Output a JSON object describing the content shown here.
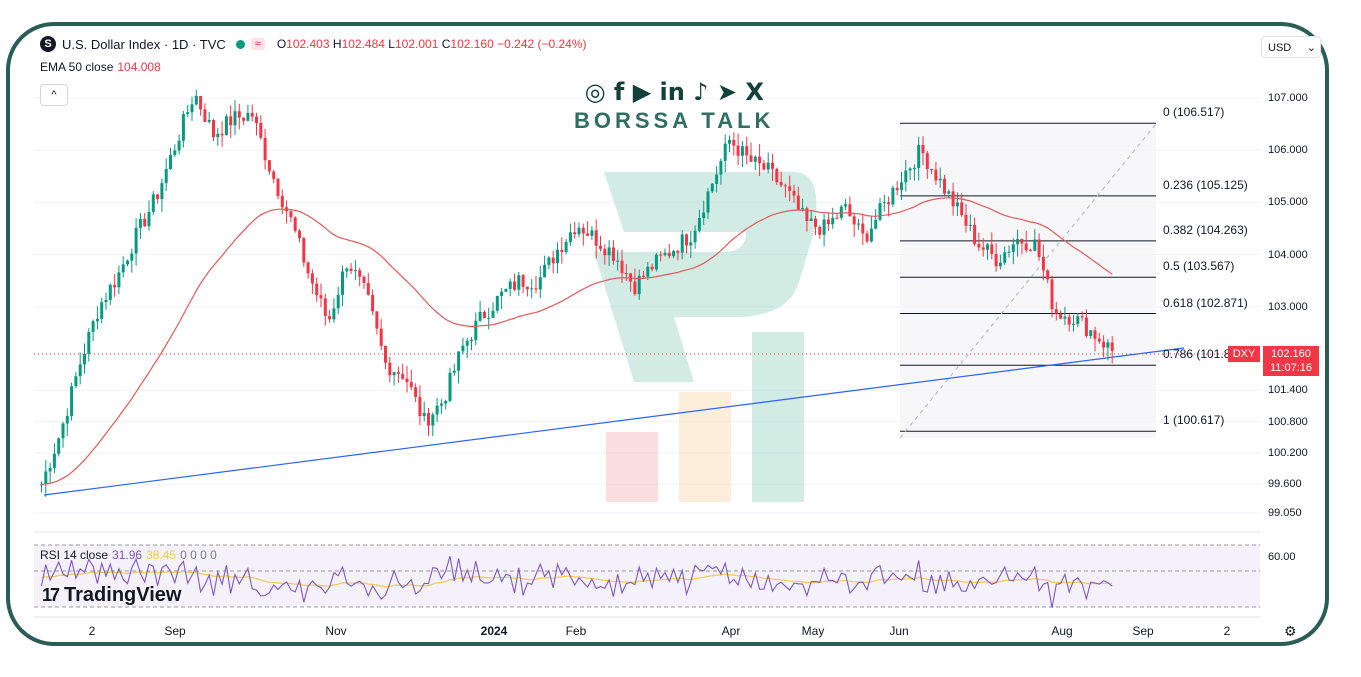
{
  "header": {
    "symbol_icon": "S",
    "title": "U.S. Dollar Index · 1D · TVC",
    "approx_icon": "≈",
    "ohlc": {
      "o_label": "O",
      "o": "102.403",
      "h_label": "H",
      "h": "102.484",
      "l_label": "L",
      "l": "102.001",
      "c_label": "C",
      "c": "102.160",
      "change": "−0.242 (−0.24%)"
    },
    "ema_label": "EMA 50 close",
    "ema_value": "104.008",
    "collapse_icon": "^",
    "currency": "USD"
  },
  "watermark": {
    "social_icons": [
      "instagram-icon",
      "facebook-icon",
      "youtube-icon",
      "linkedin-icon",
      "tiktok-icon",
      "telegram-icon",
      "x-icon"
    ],
    "social_text": "◎ f ▶ in ♪ ➤ X",
    "brand": "BORSSA TALK"
  },
  "price_axis": {
    "ticks": [
      "107.000",
      "106.000",
      "105.000",
      "104.000",
      "103.000",
      "101.400",
      "100.800",
      "100.200",
      "99.600",
      "99.050"
    ],
    "tick_values": [
      107.0,
      106.0,
      105.0,
      104.0,
      103.0,
      101.4,
      100.8,
      100.2,
      99.6,
      99.05
    ]
  },
  "last_price": {
    "symbol": "DXY",
    "price": "102.160",
    "countdown": "11:07:16"
  },
  "fib_levels": [
    {
      "label": "0 (106.517)",
      "value": 106.517
    },
    {
      "label": "0.236 (105.125)",
      "value": 105.125
    },
    {
      "label": "0.382 (104.263)",
      "value": 104.263
    },
    {
      "label": "0.5 (103.567)",
      "value": 103.567
    },
    {
      "label": "0.618 (102.871)",
      "value": 102.871
    },
    {
      "label": "0.786 (101.8",
      "value": 101.88
    },
    {
      "label": "1 (100.617)",
      "value": 100.617
    }
  ],
  "x_axis": {
    "labels": [
      "2",
      "Sep",
      "Nov",
      "2024",
      "Feb",
      "Apr",
      "May",
      "Jun",
      "Aug",
      "Sep",
      "2"
    ]
  },
  "rsi": {
    "label": "RSI 14 close",
    "value": "31.96",
    "ma_value": "38.45",
    "extra": "0 0 0 0",
    "level": "60.00"
  },
  "branding": {
    "tv_mark": "17",
    "tv_name": "TradingView"
  },
  "colors": {
    "up": "#089981",
    "down": "#f23645",
    "ema": "#e05a5a",
    "trend": "#2962ff",
    "rsi": "#7e57c2",
    "rsi_ma": "#f7c948"
  },
  "chart_data": {
    "type": "line",
    "title": "U.S. Dollar Index · 1D · TVC",
    "ylim": [
      99.05,
      107.3
    ],
    "x": [
      "2",
      "Sep",
      "Nov",
      "2024",
      "Feb",
      "Apr",
      "May",
      "Jun",
      "Aug",
      "Sep",
      "2"
    ],
    "series": [
      {
        "name": "U.S. Dollar Index",
        "values": [
          99.6,
          100.6,
          101.9,
          103.0,
          103.6,
          104.4,
          105.1,
          106.1,
          107.1,
          106.3,
          106.6,
          106.7,
          105.6,
          104.7,
          103.6,
          102.7,
          103.9,
          103.2,
          101.9,
          101.7,
          100.8,
          101.2,
          102.2,
          102.8,
          103.2,
          103.5,
          103.5,
          104.1,
          104.6,
          104.3,
          104.0,
          103.4,
          103.8,
          104.1,
          104.4,
          105.3,
          106.2,
          105.8,
          105.6,
          105.2,
          104.6,
          104.5,
          104.9,
          104.3,
          104.9,
          105.5,
          106.0,
          105.4,
          104.8,
          104.2,
          103.9,
          104.3,
          104.2,
          102.9,
          102.8,
          102.5,
          102.16
        ]
      },
      {
        "name": "EMA 50 close",
        "value_last": 104.008
      }
    ]
  }
}
